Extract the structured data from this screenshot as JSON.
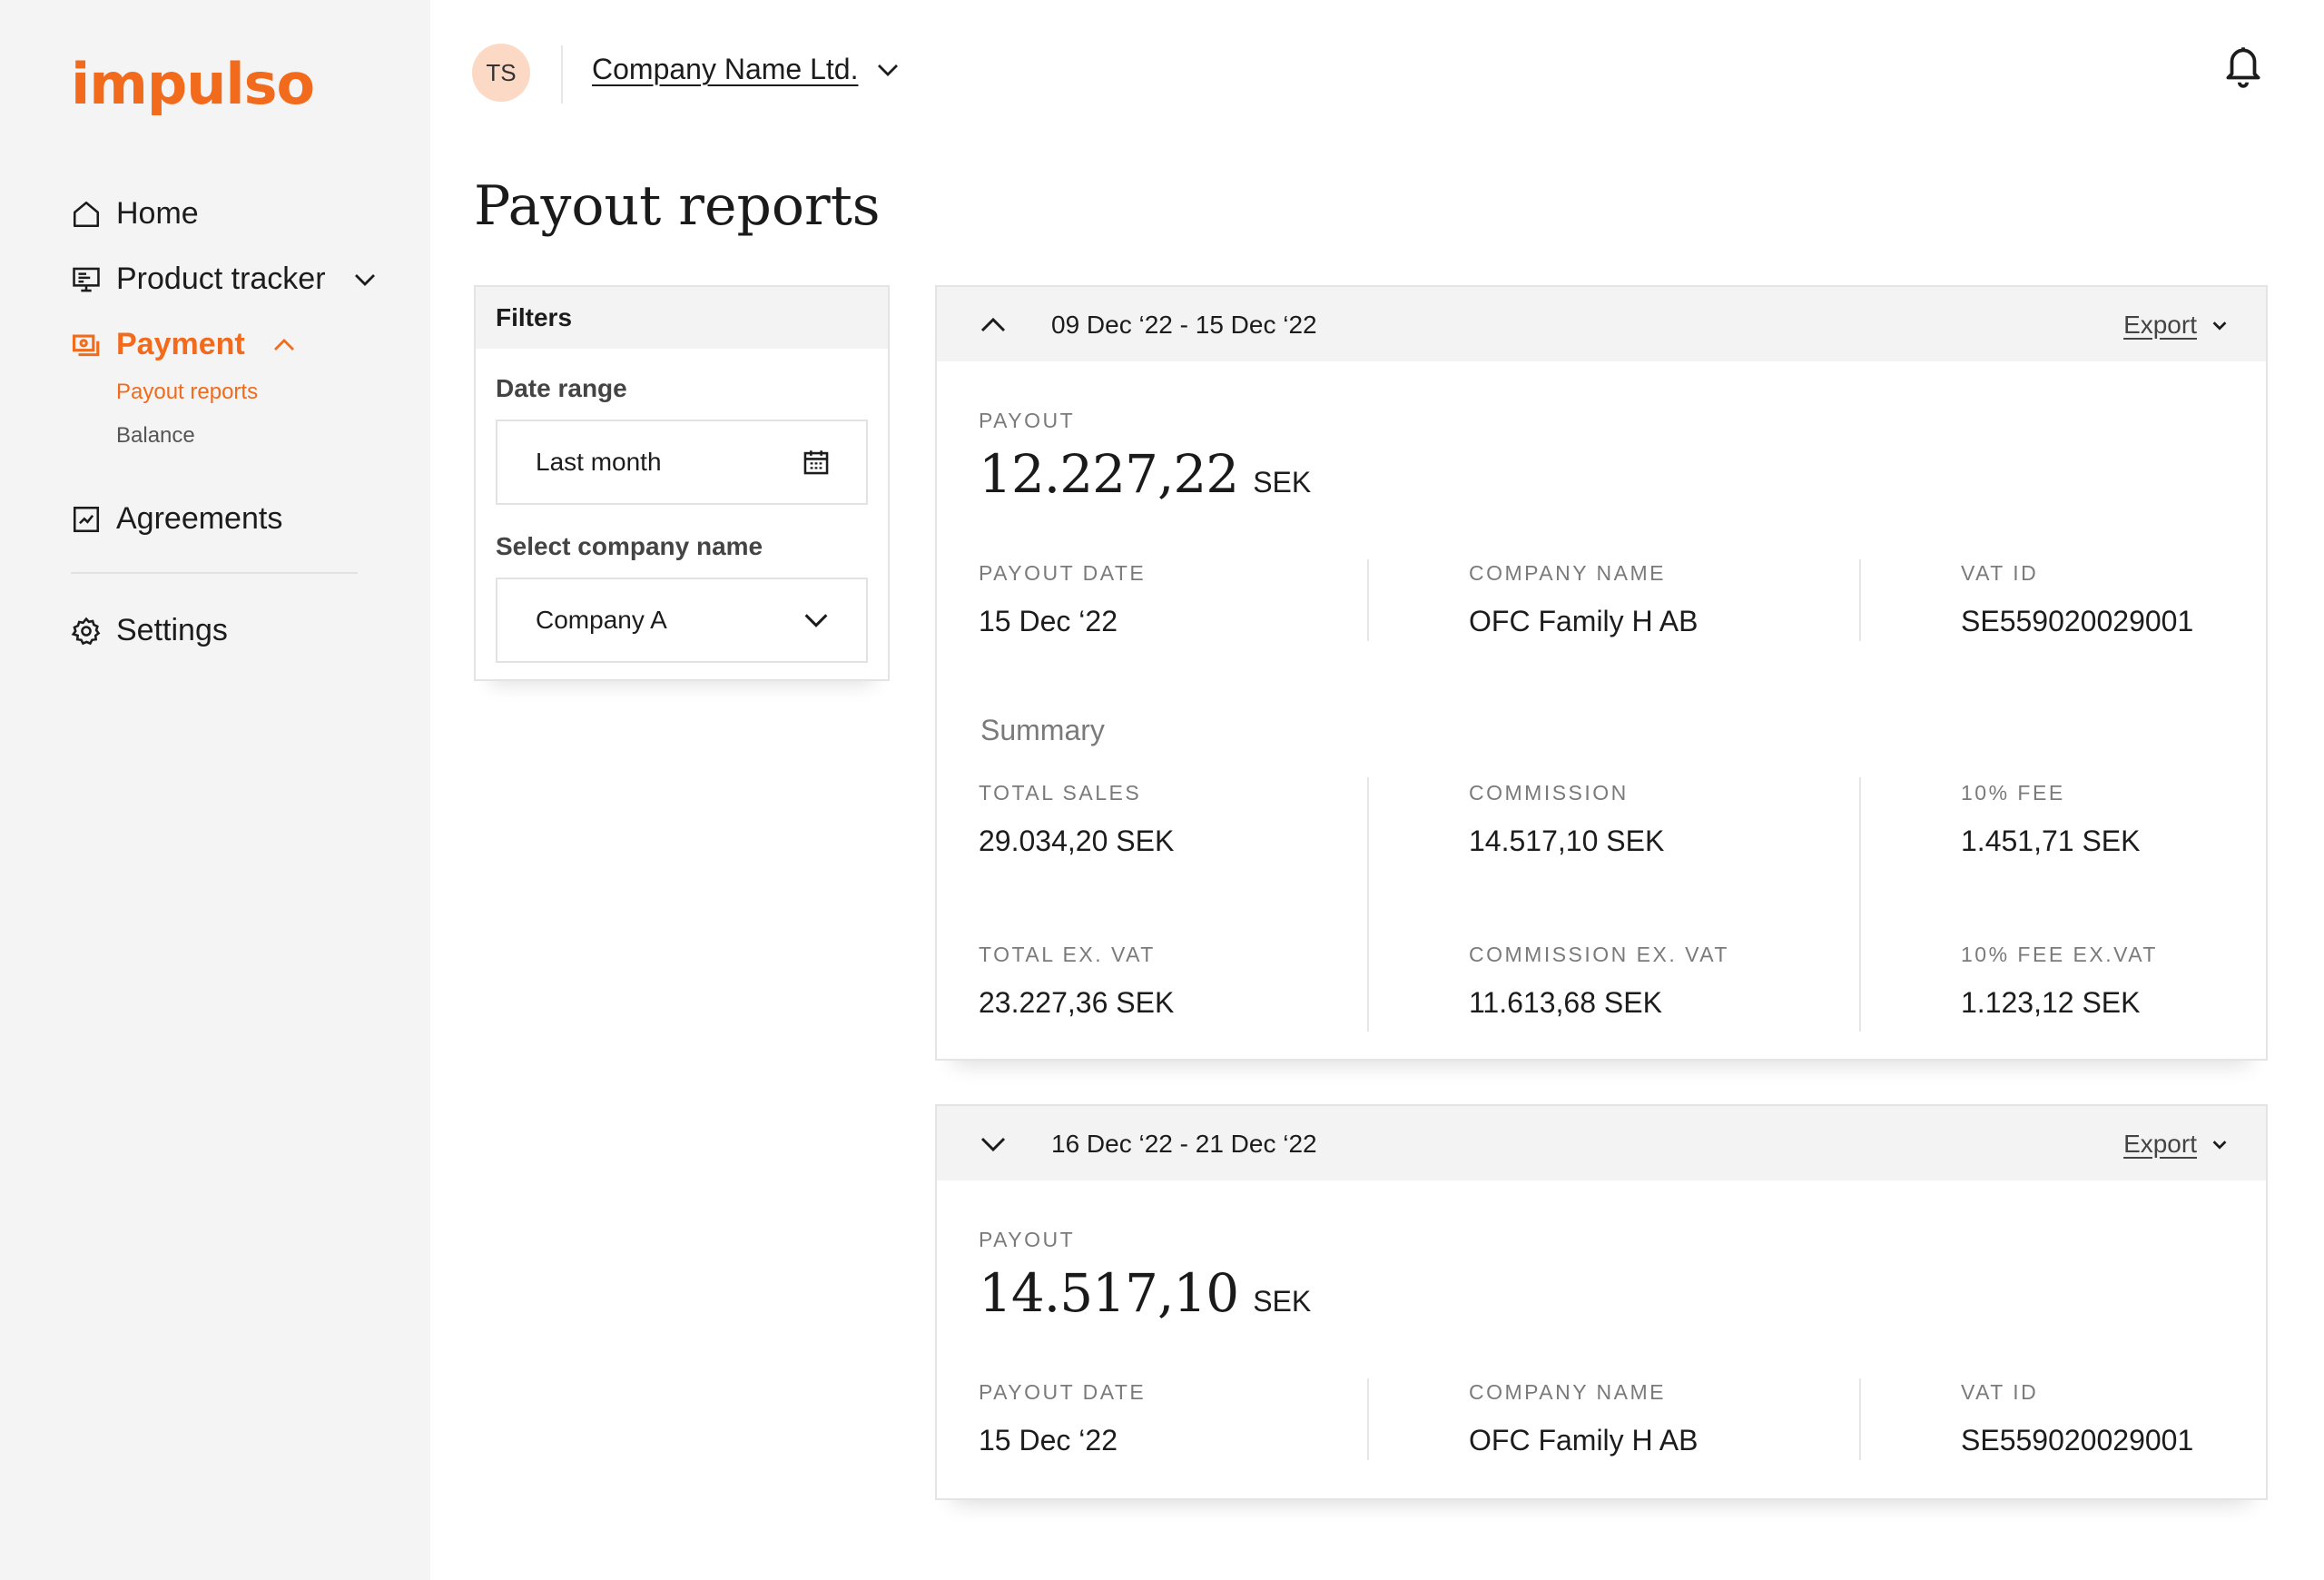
{
  "brand": {
    "logo_text": "impulso",
    "accent": "#f26a1b"
  },
  "sidebar": {
    "items": [
      {
        "label": "Home",
        "icon": "home-icon"
      },
      {
        "label": "Product tracker",
        "icon": "monitor-icon"
      },
      {
        "label": "Payment",
        "icon": "payment-icon",
        "active": true,
        "children": [
          {
            "label": "Payout reports",
            "active": true
          },
          {
            "label": "Balance"
          }
        ]
      },
      {
        "label": "Agreements",
        "icon": "chart-icon"
      },
      {
        "label": "Settings",
        "icon": "gear-icon"
      }
    ]
  },
  "topbar": {
    "avatar_initials": "TS",
    "company": "Company Name Ltd.",
    "notification_icon": "bell-icon"
  },
  "page": {
    "title": "Payout reports"
  },
  "filters": {
    "heading": "Filters",
    "date_range_label": "Date range",
    "date_range_value": "Last month",
    "company_label": "Select company name",
    "company_value": "Company A"
  },
  "reports": [
    {
      "range": "09 Dec ‘22 - 15 Dec ‘22",
      "expanded": true,
      "export_label": "Export",
      "payout_caption": "PAYOUT",
      "payout_amount": "12.227,22",
      "currency": "SEK",
      "details": [
        {
          "caption": "PAYOUT DATE",
          "value": "15 Dec ‘22"
        },
        {
          "caption": "COMPANY NAME",
          "value": "OFC Family H AB"
        },
        {
          "caption": "VAT ID",
          "value": "SE559020029001"
        }
      ],
      "summary_title": "Summary",
      "summary": [
        {
          "caption": "TOTAL SALES",
          "value": "29.034,20  SEK"
        },
        {
          "caption": "COMMISSION",
          "value": "14.517,10  SEK"
        },
        {
          "caption": "10% FEE",
          "value": "1.451,71  SEK"
        },
        {
          "caption": "TOTAL EX. VAT",
          "value": "23.227,36  SEK"
        },
        {
          "caption": "COMMISSION EX. VAT",
          "value": "11.613,68  SEK"
        },
        {
          "caption": "10% FEE EX.VAT",
          "value": "1.123,12  SEK"
        }
      ]
    },
    {
      "range": "16 Dec ‘22 - 21 Dec ‘22",
      "expanded": false,
      "export_label": "Export",
      "payout_caption": "PAYOUT",
      "payout_amount": "14.517,10",
      "currency": "SEK",
      "details": [
        {
          "caption": "PAYOUT DATE",
          "value": "15 Dec ‘22"
        },
        {
          "caption": "COMPANY NAME",
          "value": "OFC Family H AB"
        },
        {
          "caption": "VAT ID",
          "value": "SE559020029001"
        }
      ]
    }
  ]
}
